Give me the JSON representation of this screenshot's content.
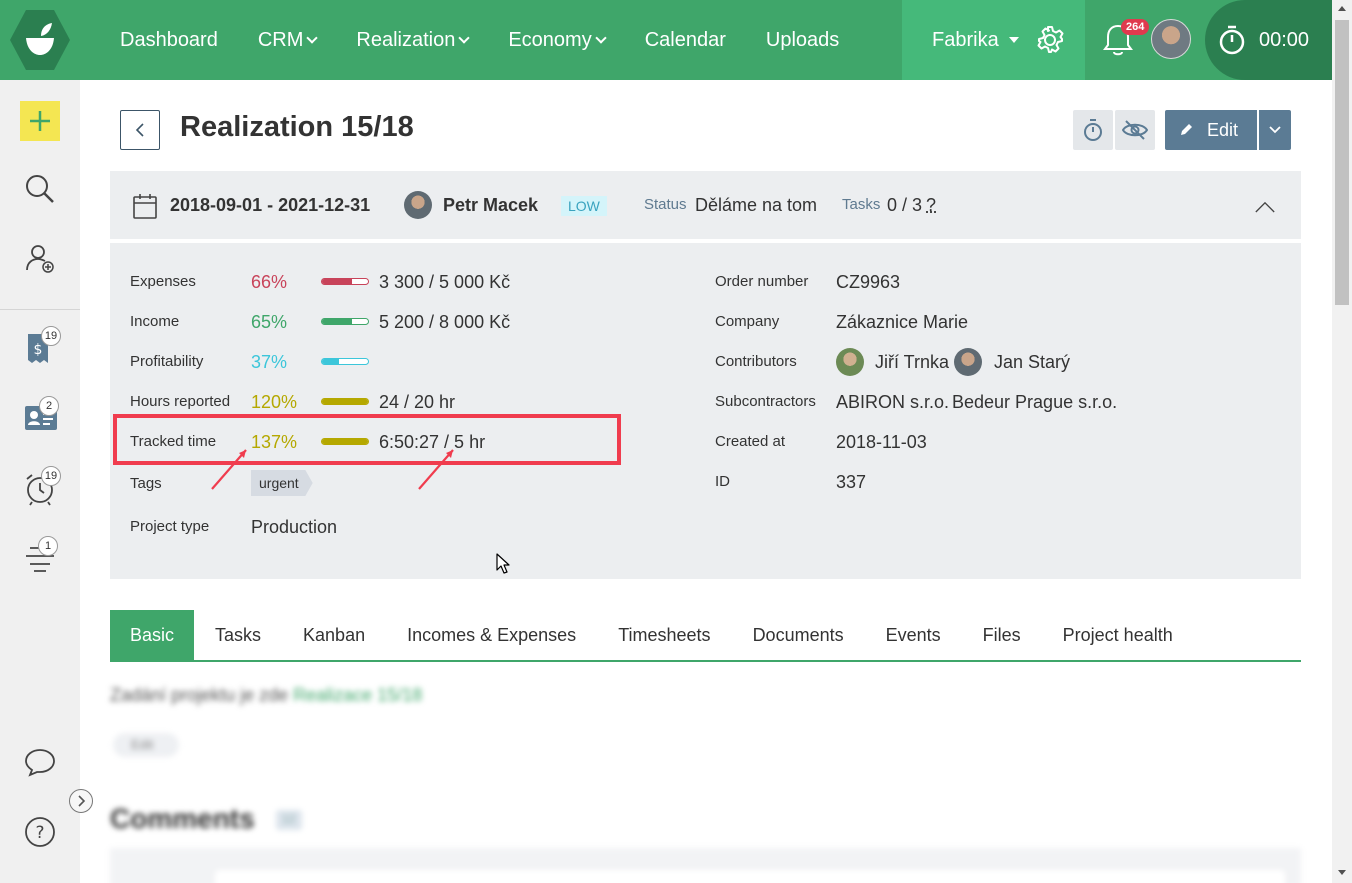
{
  "nav": {
    "items": [
      {
        "label": "Dashboard",
        "dropdown": false
      },
      {
        "label": "CRM",
        "dropdown": true
      },
      {
        "label": "Realization",
        "dropdown": true
      },
      {
        "label": "Economy",
        "dropdown": true
      },
      {
        "label": "Calendar",
        "dropdown": false
      },
      {
        "label": "Uploads",
        "dropdown": false
      }
    ],
    "company": "Fabrika",
    "notifications_count": "264",
    "timer": "00:00"
  },
  "sidebar": {
    "badges": {
      "invoices": "19",
      "contacts": "2",
      "reminders": "19",
      "tasks": "1"
    }
  },
  "header": {
    "title": "Realization 15/18",
    "edit_label": "Edit"
  },
  "summary": {
    "dates": "2018-09-01 - 2021-12-31",
    "owner": "Petr Macek",
    "priority": "LOW",
    "status_label": "Status",
    "status": "Děláme na tom",
    "tasks_label": "Tasks",
    "tasks": "0 / 3",
    "tasks_help": "?"
  },
  "details": {
    "left": {
      "expenses": {
        "label": "Expenses",
        "pct": "66%",
        "fill": 0.66,
        "value": "3 300 / 5 000 Kč",
        "color": "#c8435a"
      },
      "income": {
        "label": "Income",
        "pct": "65%",
        "fill": 0.65,
        "value": "5 200 / 8 000 Kč",
        "color": "#3fa66a"
      },
      "profitability": {
        "label": "Profitability",
        "pct": "37%",
        "fill": 0.37,
        "value": "",
        "color": "#3cc6da"
      },
      "hours": {
        "label": "Hours reported",
        "pct": "120%",
        "fill": 1.0,
        "value": "24 / 20 hr",
        "color": "#b5a800"
      },
      "tracked": {
        "label": "Tracked time",
        "pct": "137%",
        "fill": 1.0,
        "value": "6:50:27 / 5 hr",
        "color": "#b5a800"
      },
      "tags": {
        "label": "Tags",
        "value": "urgent"
      },
      "project_type": {
        "label": "Project type",
        "value": "Production"
      }
    },
    "right": {
      "order_number": {
        "label": "Order number",
        "value": "CZ9963"
      },
      "company": {
        "label": "Company",
        "value": "Zákaznice Marie"
      },
      "contributors": {
        "label": "Contributors",
        "people": [
          "Jiří Trnka",
          "Jan Starý"
        ]
      },
      "subcontractors": {
        "label": "Subcontractors",
        "value1": "ABIRON s.r.o.",
        "value2": "Bedeur Prague s.r.o."
      },
      "created_at": {
        "label": "Created at",
        "value": "2018-11-03"
      },
      "id": {
        "label": "ID",
        "value": "337"
      }
    }
  },
  "tabs": [
    "Basic",
    "Tasks",
    "Kanban",
    "Incomes & Expenses",
    "Timesheets",
    "Documents",
    "Events",
    "Files",
    "Project health"
  ],
  "content": {
    "intro_text": "Zadání projektu je zde",
    "intro_link": "Realizace 15/18",
    "edit_chip": "Edit",
    "comments_title": "Comments",
    "comments_count": "12"
  },
  "colors": {
    "brand_green": "#3fa66a",
    "annotation_red": "#f03c4e",
    "edit_button": "#5b7b94"
  }
}
